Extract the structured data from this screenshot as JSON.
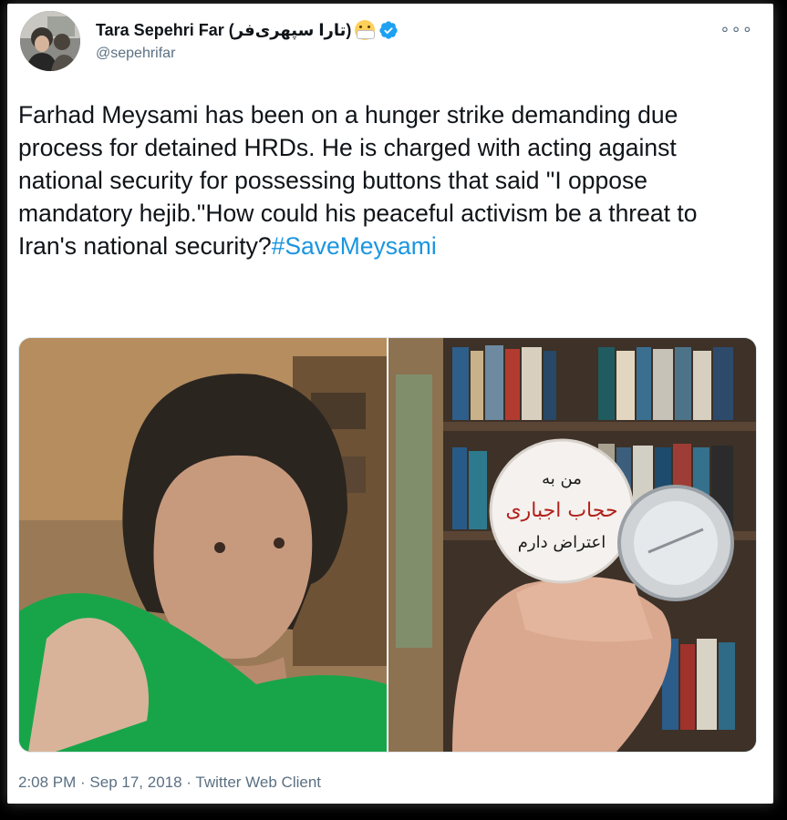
{
  "author": {
    "display_name": "Tara Sepehri Far (تارا سپهری‌فر)",
    "handle": "@sepehrifar",
    "emoji": "face-with-medical-mask",
    "verified": true
  },
  "tweet": {
    "text": "Farhad Meysami has been on a hunger strike demanding due process for detained HRDs. He is charged with acting against national security for possessing buttons that said \"I oppose mandatory hejib.\"How could his peaceful activism be a threat to Iran's national security?",
    "hashtag": "#SaveMeysami"
  },
  "media": {
    "images": [
      {
        "name": "portrait-photo",
        "description_icon": "photo-icon"
      },
      {
        "name": "button-photo",
        "description_icon": "photo-icon"
      }
    ],
    "button_text": [
      "من به",
      "حجاب اجباری",
      "اعتراض دارم"
    ]
  },
  "meta": {
    "time": "2:08 PM",
    "date": "Sep 17, 2018",
    "client": "Twitter Web Client",
    "separator": " · "
  },
  "colors": {
    "link": "#1b95e0",
    "text": "#0f1419",
    "secondary": "#5b7083",
    "verified": "#1da1f2"
  }
}
